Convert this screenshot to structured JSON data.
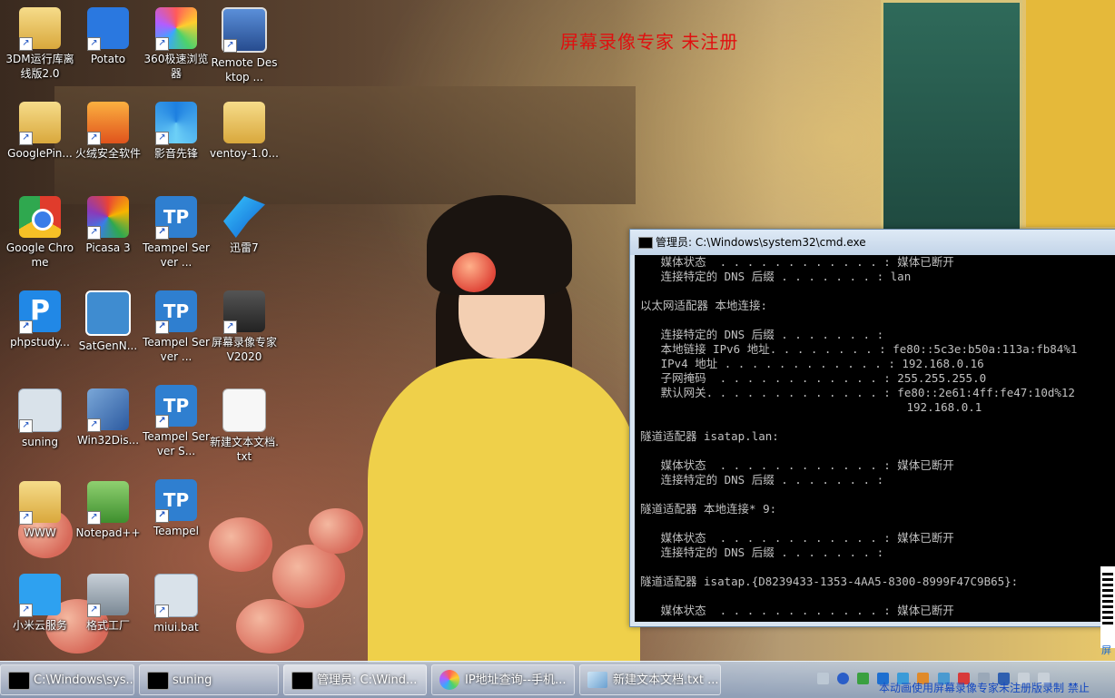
{
  "watermark": "屏幕录像专家 未注册",
  "desktop_icons": [
    {
      "label": "3DM运行库离线版2.0"
    },
    {
      "label": "Potato"
    },
    {
      "label": "360极速浏览器"
    },
    {
      "label": "Remote Desktop ..."
    },
    {
      "label": "GooglePin..."
    },
    {
      "label": "火绒安全软件"
    },
    {
      "label": "影音先锋"
    },
    {
      "label": "ventoy-1.0..."
    },
    {
      "label": "Google Chrome"
    },
    {
      "label": "Picasa 3"
    },
    {
      "label": "Teampel Server ..."
    },
    {
      "label": "迅雷7"
    },
    {
      "label": "phpstudy..."
    },
    {
      "label": "SatGenN..."
    },
    {
      "label": "Teampel Server ..."
    },
    {
      "label": "屏幕录像专家V2020"
    },
    {
      "label": "suning"
    },
    {
      "label": "Win32Dis..."
    },
    {
      "label": "Teampel Server S..."
    },
    {
      "label": "新建文本文档.txt"
    },
    {
      "label": "WWW"
    },
    {
      "label": "Notepad++"
    },
    {
      "label": "Teampel"
    },
    {
      "label": "小米云服务"
    },
    {
      "label": "格式工厂"
    },
    {
      "label": "miui.bat"
    }
  ],
  "cmd_window": {
    "title": "管理员: C:\\Windows\\system32\\cmd.exe",
    "lines": [
      "   媒体状态  . . . . . . . . . . . . : 媒体已断开",
      "   连接特定的 DNS 后缀 . . . . . . . : lan",
      "",
      "以太网适配器 本地连接:",
      "",
      "   连接特定的 DNS 后缀 . . . . . . . :",
      "   本地链接 IPv6 地址. . . . . . . . : fe80::5c3e:b50a:113a:fb84%1",
      "   IPv4 地址 . . . . . . . . . . . . : 192.168.0.16",
      "   子网掩码  . . . . . . . . . . . . : 255.255.255.0",
      "   默认网关. . . . . . . . . . . . . : fe80::2e61:4ff:fe47:10d%12",
      "                                       192.168.0.1",
      "",
      "隧道适配器 isatap.lan:",
      "",
      "   媒体状态  . . . . . . . . . . . . : 媒体已断开",
      "   连接特定的 DNS 后缀 . . . . . . . :",
      "",
      "隧道适配器 本地连接* 9:",
      "",
      "   媒体状态  . . . . . . . . . . . . : 媒体已断开",
      "   连接特定的 DNS 后缀 . . . . . . . :",
      "",
      "隧道适配器 isatap.{D8239433-1353-4AA5-8300-8999F47C9B65}:",
      "",
      "   媒体状态  . . . . . . . . . . . . : 媒体已断开"
    ]
  },
  "qr_text": "屏",
  "taskbar": {
    "tasks": [
      {
        "label": "C:\\Windows\\sys..."
      },
      {
        "label": "suning"
      },
      {
        "label": "管理员: C:\\Wind..."
      },
      {
        "label": "IP地址查询--手机..."
      },
      {
        "label": "新建文本文档.txt ..."
      }
    ],
    "status_text": "本动画使用屏幕录像专家未注册版录制 禁止"
  }
}
